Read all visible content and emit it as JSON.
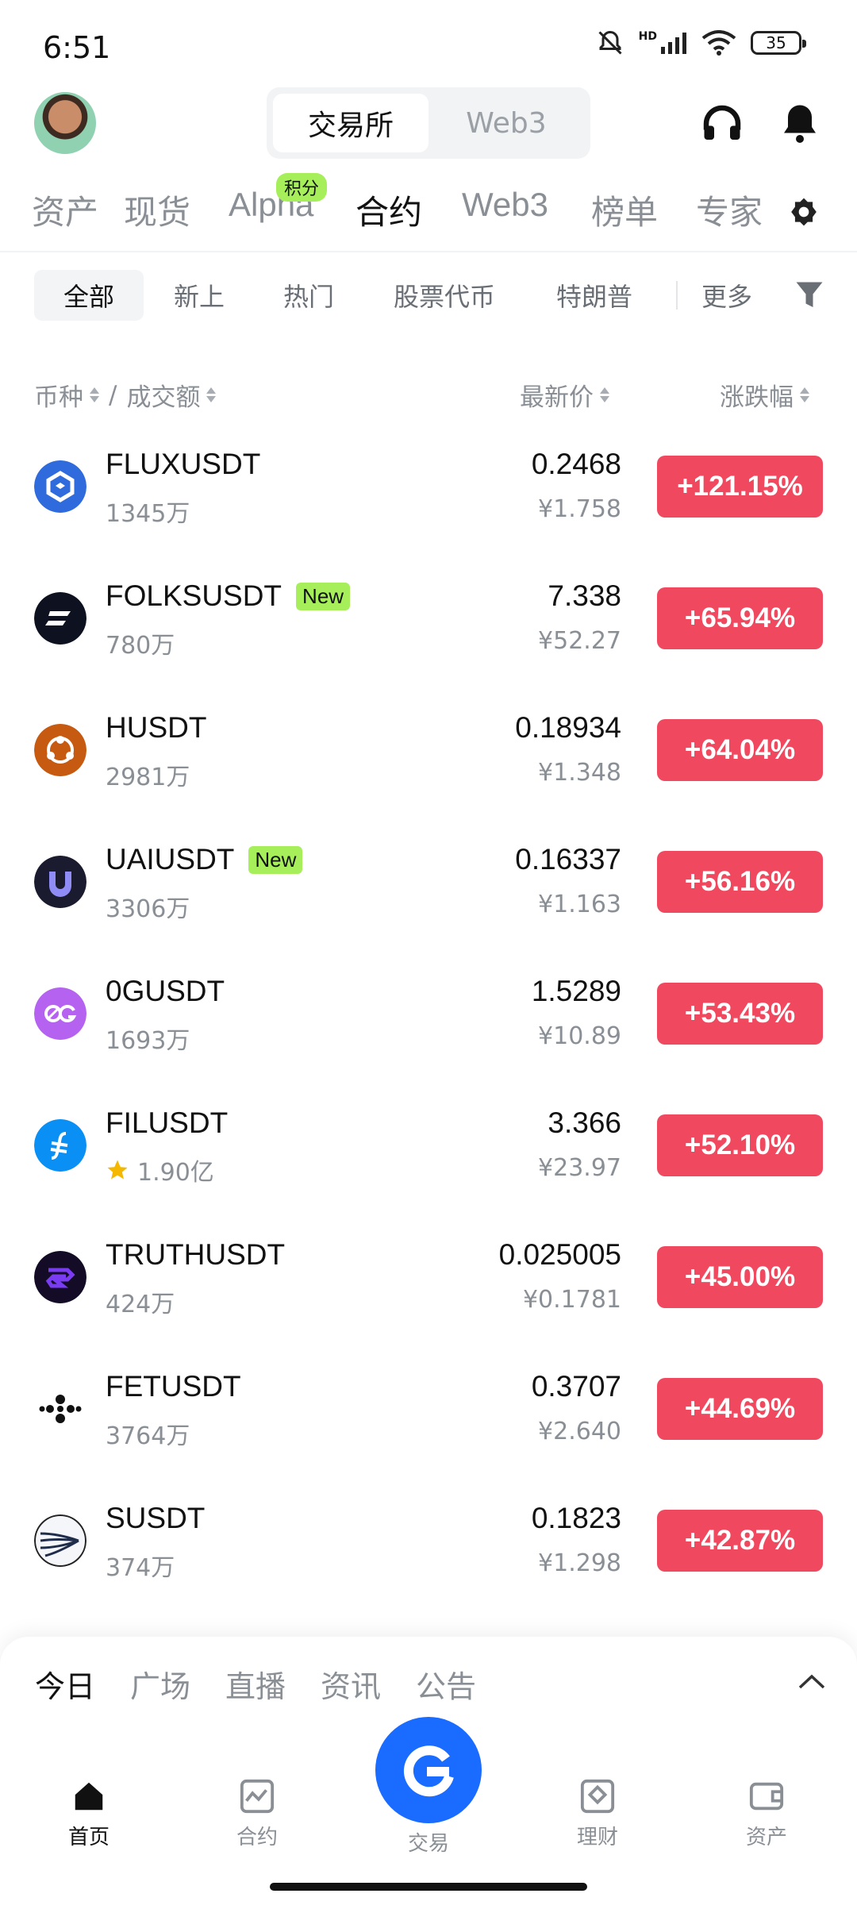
{
  "status_bar": {
    "time": "6:51",
    "battery": "35",
    "network": "HD"
  },
  "header": {
    "segments": [
      "交易所",
      "Web3"
    ],
    "active_segment": 0
  },
  "category_tabs": {
    "items": [
      "资产",
      "现货",
      "Alpha",
      "合约",
      "Web3",
      "榜单",
      "专家"
    ],
    "active": "合约",
    "alpha_badge": "积分"
  },
  "filters": {
    "items": [
      "全部",
      "新上",
      "热门",
      "股票代币",
      "特朗普"
    ],
    "more": "更多",
    "active": "全部"
  },
  "columns": {
    "pair": "币种",
    "volume": "成交额",
    "price": "最新价",
    "change": "涨跌幅",
    "separator": "/"
  },
  "rows": [
    {
      "symbol": "FLUXUSDT",
      "volume": "1345万",
      "price": "0.2468",
      "cny": "¥1.758",
      "change": "+121.15%",
      "logo_color": "#2f6bdc",
      "new_tag": ""
    },
    {
      "symbol": "FOLKSUSDT",
      "volume": "780万",
      "price": "7.338",
      "cny": "¥52.27",
      "change": "+65.94%",
      "logo_color": "#0e1220",
      "new_tag": "New"
    },
    {
      "symbol": "HUSDT",
      "volume": "2981万",
      "price": "0.18934",
      "cny": "¥1.348",
      "change": "+64.04%",
      "logo_color": "#c65a11",
      "new_tag": ""
    },
    {
      "symbol": "UAIUSDT",
      "volume": "3306万",
      "price": "0.16337",
      "cny": "¥1.163",
      "change": "+56.16%",
      "logo_color": "#1b1b2f",
      "new_tag": "New"
    },
    {
      "symbol": "0GUSDT",
      "volume": "1693万",
      "price": "1.5289",
      "cny": "¥10.89",
      "change": "+53.43%",
      "logo_color": "#b562f0",
      "new_tag": ""
    },
    {
      "symbol": "FILUSDT",
      "volume": "1.90亿",
      "price": "3.366",
      "cny": "¥23.97",
      "change": "+52.10%",
      "logo_color": "#0a90f5",
      "new_tag": "",
      "starred": true
    },
    {
      "symbol": "TRUTHUSDT",
      "volume": "424万",
      "price": "0.025005",
      "cny": "¥0.1781",
      "change": "+45.00%",
      "logo_color": "#140c26",
      "new_tag": ""
    },
    {
      "symbol": "FETUSDT",
      "volume": "3764万",
      "price": "0.3707",
      "cny": "¥2.640",
      "change": "+44.69%",
      "logo_color": "#ffffff",
      "new_tag": ""
    },
    {
      "symbol": "SUSDT",
      "volume": "374万",
      "price": "0.1823",
      "cny": "¥1.298",
      "change": "+42.87%",
      "logo_color": "#f4f6fa",
      "new_tag": ""
    }
  ],
  "news_tabs": [
    "今日",
    "广场",
    "直播",
    "资讯",
    "公告"
  ],
  "bottom_nav": {
    "home": "首页",
    "futures": "合约",
    "trade": "交易",
    "earn": "理财",
    "assets": "资产"
  },
  "colors": {
    "up": "#f0485e",
    "accent": "#1a6bff",
    "badge": "#a6ef5a"
  }
}
